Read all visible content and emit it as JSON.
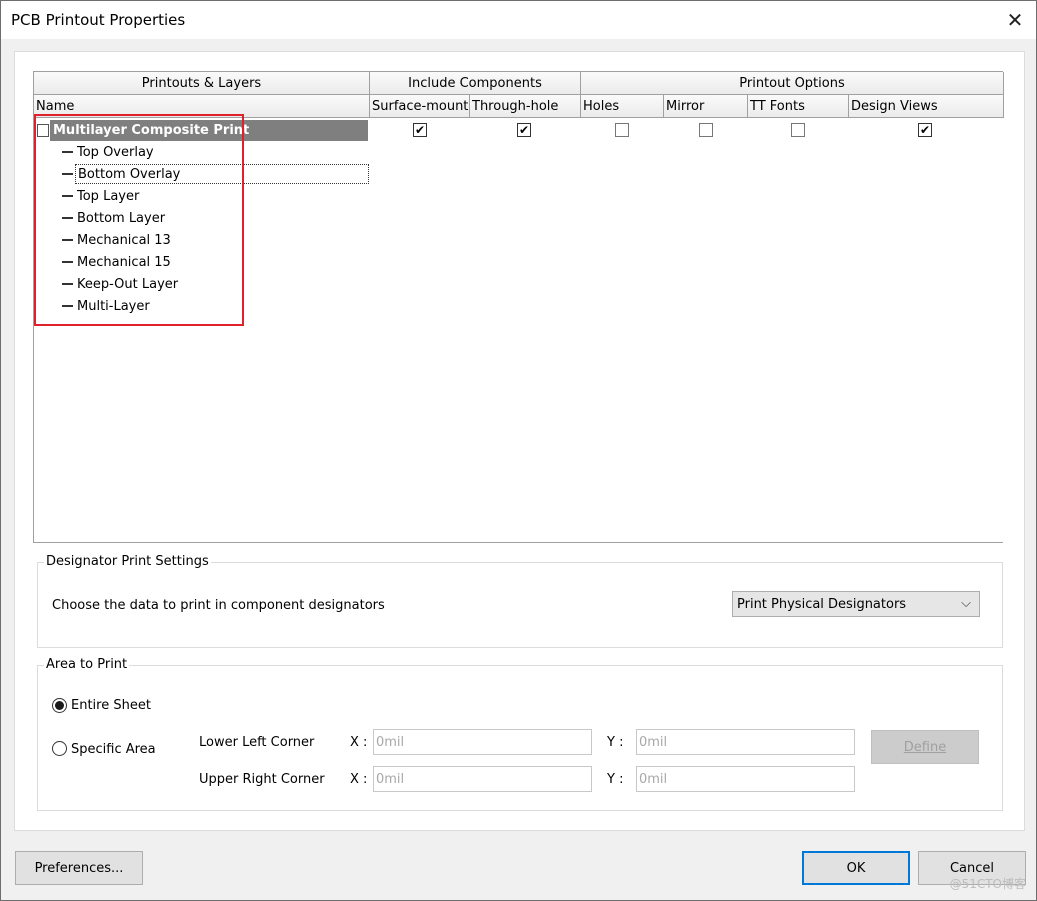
{
  "window": {
    "title": "PCB Printout Properties"
  },
  "grid": {
    "groups": [
      "Printouts & Layers",
      "Include Components",
      "Printout Options"
    ],
    "columns": [
      "Name",
      "Surface-mount",
      "Through-hole",
      "Holes",
      "Mirror",
      "TT Fonts",
      "Design Views"
    ],
    "root": {
      "label": "Multilayer Composite Print",
      "surface_mount": true,
      "through_hole": true,
      "holes": false,
      "mirror": false,
      "tt_fonts": false,
      "design_views": true
    },
    "layers": [
      "Top Overlay",
      "Bottom Overlay",
      "Top Layer",
      "Bottom Layer",
      "Mechanical 13",
      "Mechanical 15",
      "Keep-Out Layer",
      "Multi-Layer"
    ],
    "focused_layer_index": 1
  },
  "designator": {
    "title": "Designator Print Settings",
    "prompt": "Choose the data to print in component designators",
    "selected": "Print Physical Designators"
  },
  "area": {
    "title": "Area to Print",
    "options": [
      "Entire Sheet",
      "Specific Area"
    ],
    "selected_index": 0,
    "lower_left_label": "Lower Left Corner",
    "upper_right_label": "Upper Right Corner",
    "x_label": "X :",
    "y_label": "Y :",
    "lower_left_x_placeholder": "0mil",
    "lower_left_y_placeholder": "0mil",
    "upper_right_x_placeholder": "0mil",
    "upper_right_y_placeholder": "0mil",
    "define_label": "Define"
  },
  "buttons": {
    "preferences": "Preferences...",
    "ok": "OK",
    "cancel": "Cancel"
  },
  "watermark": "@51CTO博客"
}
